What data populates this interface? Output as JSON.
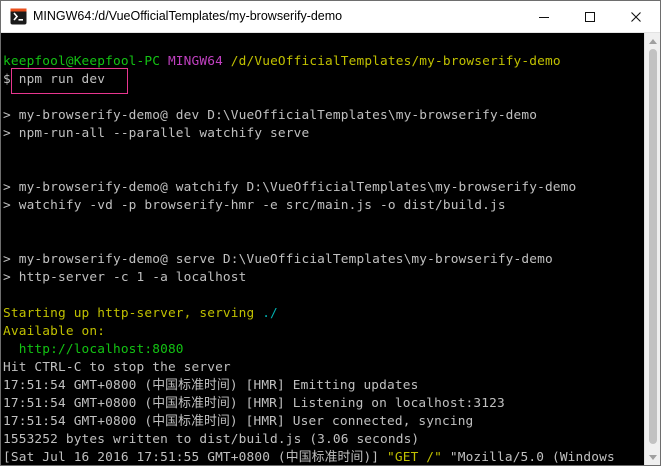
{
  "window": {
    "title": "MINGW64:/d/VueOfficialTemplates/my-browserify-demo",
    "icon": "git-bash-icon",
    "buttons": {
      "minimize": "minimize-icon",
      "maximize": "maximize-icon",
      "close": "close-icon"
    }
  },
  "colors": {
    "prompt_user": "#13c313",
    "prompt_host": "#c040c0",
    "prompt_path": "#c0c000",
    "text": "#c0c0c0",
    "url": "#00b0b0",
    "highlight_box": "#e8368f"
  },
  "terminal": {
    "prompt": {
      "user": "keepfool@Keepfool-PC",
      "shell": "MINGW64",
      "path": "/d/VueOfficialTemplates/my-browserify-demo"
    },
    "command": "$ npm run dev",
    "output": [
      "> my-browserify-demo@ dev D:\\VueOfficialTemplates\\my-browserify-demo",
      "> npm-run-all --parallel watchify serve",
      "> my-browserify-demo@ watchify D:\\VueOfficialTemplates\\my-browserify-demo",
      "> watchify -vd -p browserify-hmr -e src/main.js -o dist/build.js",
      "> my-browserify-demo@ serve D:\\VueOfficialTemplates\\my-browserify-demo",
      "> http-server -c 1 -a localhost"
    ],
    "server": {
      "starting_prefix": "Starting up http-server, serving ",
      "starting_path": "./",
      "available": "Available on:",
      "url": "  http://localhost:8080",
      "hint": "Hit CTRL-C to stop the server"
    },
    "logs": [
      "17:51:54 GMT+0800 (中国标准时间) [HMR] Emitting updates",
      "17:51:54 GMT+0800 (中国标准时间) [HMR] Listening on localhost:3123",
      "17:51:54 GMT+0800 (中国标准时间) [HMR] User connected, syncing",
      "1553252 bytes written to dist/build.js (3.06 seconds)"
    ],
    "request": {
      "prefix": "[Sat Jul 16 2016 17:51:55 GMT+0800 (中国标准时间)] ",
      "method": "\"GET /\"",
      "suffix": " \"Mozilla/5.0 (Windows"
    }
  }
}
